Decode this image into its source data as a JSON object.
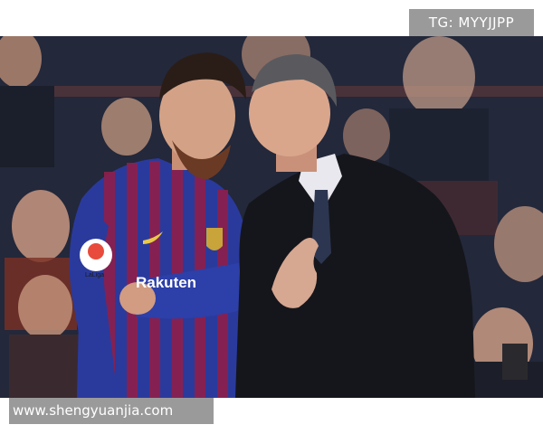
{
  "watermark": {
    "top_right": "TG: MYYJJPP",
    "bottom_left": "www.shengyuanjia.com"
  },
  "jersey": {
    "sponsor": "Rakuten",
    "league_badge": "LaLiga"
  },
  "colors": {
    "badge_bg": "#9a9a9a",
    "jersey_blue": "#2a3a9c",
    "jersey_red": "#8e1f4a",
    "coat": "#15161b"
  }
}
